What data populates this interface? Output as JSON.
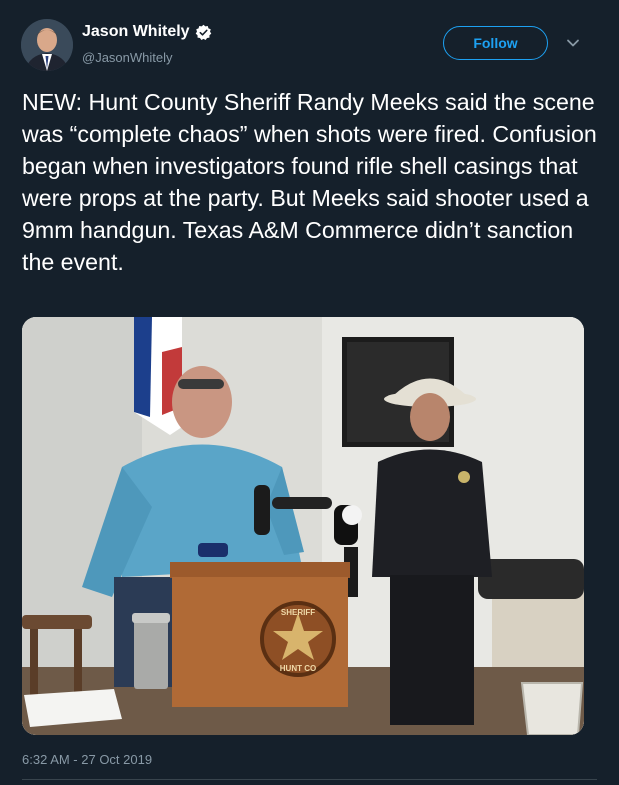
{
  "tweet": {
    "author": {
      "display_name": "Jason Whitely",
      "handle": "@JasonWhitely",
      "verified": true
    },
    "follow_label": "Follow",
    "text": "NEW: Hunt County Sheriff Randy Meeks said the scene was “complete chaos” when shots were fired. Confusion began when investigators found rifle shell casings that were props at the party. But Meeks said shooter used a 9mm handgun. Texas A&M Commerce didn’t sanction the event.",
    "photo": {
      "podium_seal_top": "SHERIFF",
      "podium_seal_bottom": "HUNT CO"
    },
    "timestamp": "6:32 AM - 27 Oct 2019"
  },
  "icons": {
    "verified": "verified-badge-icon",
    "caret": "chevron-down-icon"
  },
  "colors": {
    "background": "#15202b",
    "accent": "#1da1f2",
    "secondary_text": "#8899a6",
    "divider": "#38444d"
  }
}
